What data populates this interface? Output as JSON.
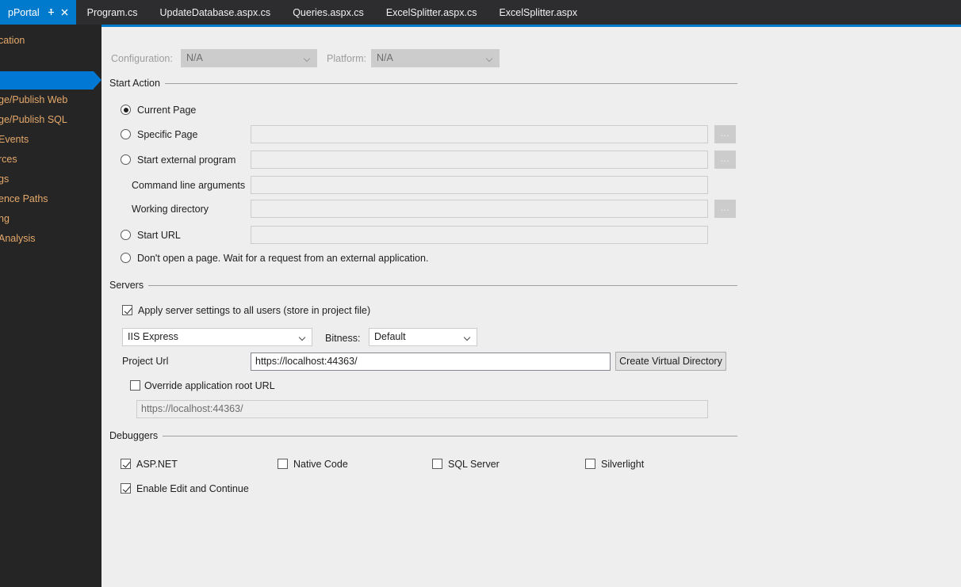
{
  "tabs": {
    "active": {
      "label": "pPortal",
      "pin_icon": "pin-icon",
      "close_icon": "close-icon"
    },
    "items": [
      {
        "label": "Program.cs"
      },
      {
        "label": "UpdateDatabase.aspx.cs"
      },
      {
        "label": "Queries.aspx.cs"
      },
      {
        "label": "ExcelSplitter.aspx.cs"
      },
      {
        "label": "ExcelSplitter.aspx"
      }
    ]
  },
  "sidebar": {
    "items": [
      {
        "label": "cation",
        "selected": false
      },
      {
        "label": "",
        "selected": true
      },
      {
        "label": "ge/Publish Web",
        "selected": false
      },
      {
        "label": "ge/Publish SQL",
        "selected": false
      },
      {
        "label": "Events",
        "selected": false
      },
      {
        "label": "rces",
        "selected": false
      },
      {
        "label": "gs",
        "selected": false
      },
      {
        "label": "ence Paths",
        "selected": false
      },
      {
        "label": "ng",
        "selected": false
      },
      {
        "label": "Analysis",
        "selected": false
      }
    ]
  },
  "config_bar": {
    "configuration_label": "Configuration:",
    "configuration_value": "N/A",
    "platform_label": "Platform:",
    "platform_value": "N/A"
  },
  "start_action": {
    "title": "Start Action",
    "current_page_label": "Current Page",
    "specific_page_label": "Specific Page",
    "specific_page_value": "",
    "start_external_program_label": "Start external program",
    "start_external_program_value": "",
    "command_line_arguments_label": "Command line arguments",
    "command_line_arguments_value": "",
    "working_directory_label": "Working directory",
    "working_directory_value": "",
    "start_url_label": "Start URL",
    "start_url_value": "",
    "dont_open_page_label": "Don't open a page.  Wait for a request from an external application.",
    "browse_label": "..."
  },
  "servers": {
    "title": "Servers",
    "apply_server_settings_label": "Apply server settings to all users (store in project file)",
    "server_value": "IIS Express",
    "bitness_label": "Bitness:",
    "bitness_value": "Default",
    "project_url_label": "Project Url",
    "project_url_value": "https://localhost:44363/",
    "create_virtual_directory_label": "Create Virtual Directory",
    "override_root_url_label": "Override application root URL",
    "override_root_url_value": "https://localhost:44363/"
  },
  "debuggers": {
    "title": "Debuggers",
    "aspnet_label": "ASP.NET",
    "native_code_label": "Native Code",
    "sql_server_label": "SQL Server",
    "silverlight_label": "Silverlight",
    "enable_edit_continue_label": "Enable Edit and Continue"
  },
  "colors": {
    "accent": "#007acc",
    "selection": "#0078d4",
    "tabstrip_bg": "#2d2d30",
    "sidebar_bg": "#252526",
    "pane_bg": "#eeeeee"
  }
}
